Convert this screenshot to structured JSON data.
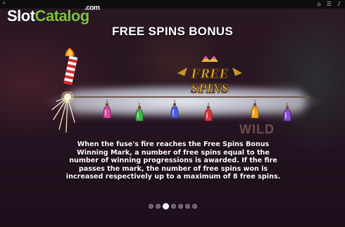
{
  "watermark": {
    "slot": "Slot",
    "catalog": "Catalog",
    "com": ".com"
  },
  "topbar": {
    "corner_text": "o"
  },
  "title": "FREE SPINS BONUS",
  "logo": {
    "line1": "FREE",
    "line2": "SPINS"
  },
  "background_text": "WILD",
  "description": "When the fuse's fire reaches the Free Spins Bonus Winning Mark, a number of free spins equal to the number of winning progressions is awarded. If the fire passes the mark, the number of free spins won is increased respectively up to a maximum of 8 free spins.",
  "pagination": {
    "total": 7,
    "active_index": 2
  },
  "colors": {
    "watermark_green": "#7cc242",
    "logo_gold": "#e8b83a",
    "bottle_pink": "#d94aa0",
    "bottle_green": "#3fb44a",
    "bottle_blue": "#4c5ee0",
    "bottle_red": "#e0353a",
    "bottle_orange": "#f0a21e",
    "bottle_purple": "#8a4bd6"
  }
}
